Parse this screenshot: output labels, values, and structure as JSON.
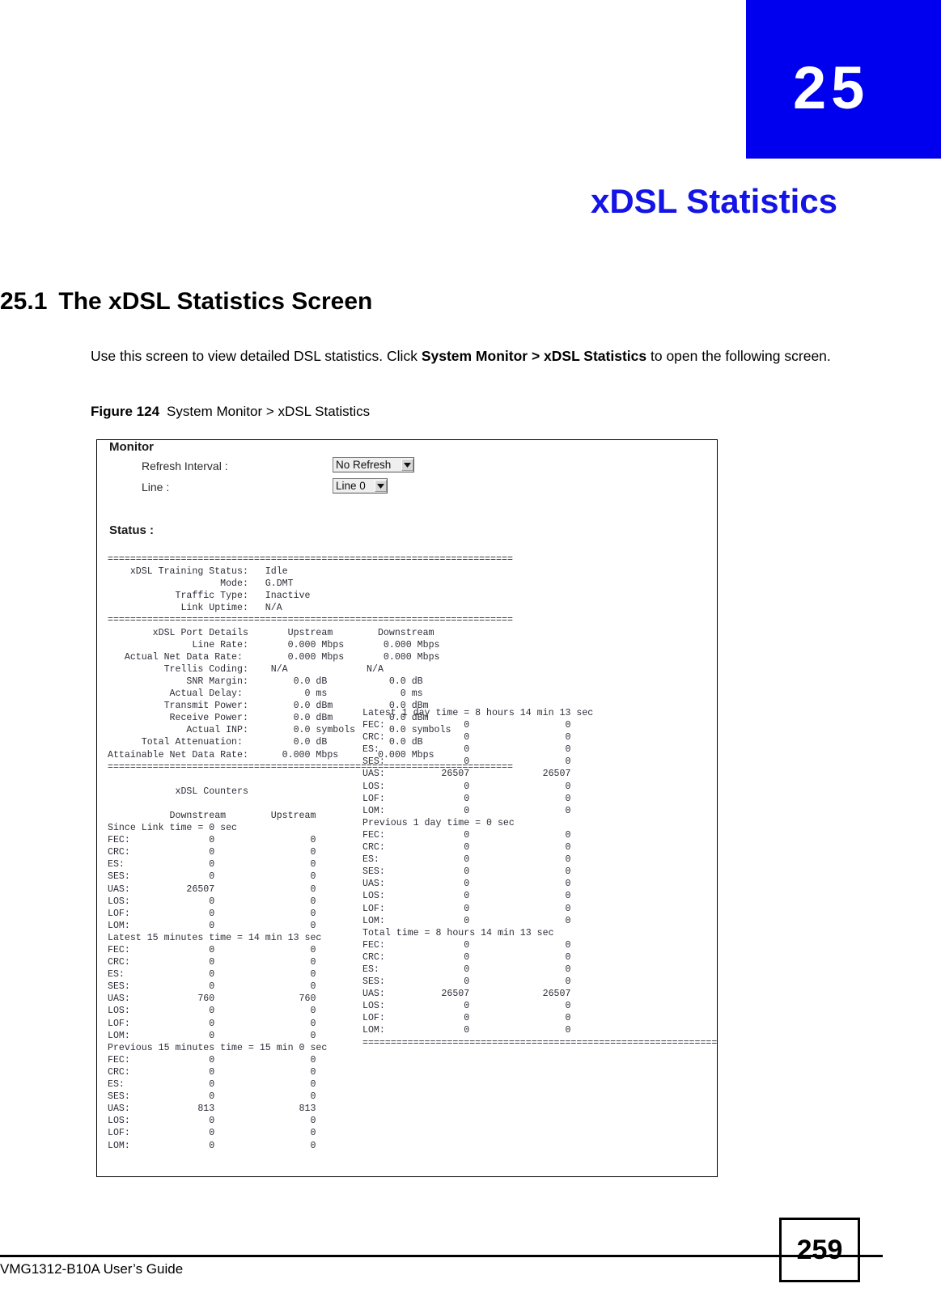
{
  "chapter": {
    "number": "25",
    "title": "xDSL Statistics"
  },
  "section": {
    "number": "25.1",
    "heading": "The xDSL Statistics Screen",
    "intro_pre": "Use this screen to view detailed DSL statistics. Click ",
    "intro_bold": "System Monitor > xDSL Statistics",
    "intro_post": " to open the following screen."
  },
  "figure": {
    "label": "Figure 124",
    "caption": "System Monitor > xDSL Statistics"
  },
  "screenshot": {
    "monitor_title": "Monitor",
    "refresh_interval_label": "Refresh Interval :",
    "refresh_interval_value": "No Refresh",
    "line_label": "Line :",
    "line_value": "Line 0",
    "status_label": "Status :",
    "console_left": "========================================================================\n    xDSL Training Status:   Idle\n                    Mode:   G.DMT\n            Traffic Type:   Inactive\n             Link Uptime:   N/A\n========================================================================\n        xDSL Port Details       Upstream        Downstream\n               Line Rate:       0.000 Mbps       0.000 Mbps\n   Actual Net Data Rate:        0.000 Mbps       0.000 Mbps\n          Trellis Coding:    N/A              N/A\n              SNR Margin:        0.0 dB           0.0 dB\n           Actual Delay:           0 ms             0 ms\n          Transmit Power:        0.0 dBm          0.0 dBm\n           Receive Power:        0.0 dBm          0.0 dBm\n              Actual INP:        0.0 symbols      0.0 symbols\n      Total Attenuation:         0.0 dB           0.0 dB\nAttainable Net Data Rate:      0.000 Mbps       0.000 Mbps\n========================================================================\n\n            xDSL Counters\n\n           Downstream        Upstream\nSince Link time = 0 sec\nFEC:              0                 0\nCRC:              0                 0\nES:               0                 0\nSES:              0                 0\nUAS:          26507                 0\nLOS:              0                 0\nLOF:              0                 0\nLOM:              0                 0\nLatest 15 minutes time = 14 min 13 sec\nFEC:              0                 0\nCRC:              0                 0\nES:               0                 0\nSES:              0                 0\nUAS:            760               760\nLOS:              0                 0\nLOF:              0                 0\nLOM:              0                 0\nPrevious 15 minutes time = 15 min 0 sec\nFEC:              0                 0\nCRC:              0                 0\nES:               0                 0\nSES:              0                 0\nUAS:            813               813\nLOS:              0                 0\nLOF:              0                 0\nLOM:              0                 0",
    "console_right": "Latest 1 day time = 8 hours 14 min 13 sec\nFEC:              0                 0\nCRC:              0                 0\nES:               0                 0\nSES:              0                 0\nUAS:          26507             26507\nLOS:              0                 0\nLOF:              0                 0\nLOM:              0                 0\nPrevious 1 day time = 0 sec\nFEC:              0                 0\nCRC:              0                 0\nES:               0                 0\nSES:              0                 0\nUAS:              0                 0\nLOS:              0                 0\nLOF:              0                 0\nLOM:              0                 0\nTotal time = 8 hours 14 min 13 sec\nFEC:              0                 0\nCRC:              0                 0\nES:               0                 0\nSES:              0                 0\nUAS:          26507             26507\nLOS:              0                 0\nLOF:              0                 0\nLOM:              0                 0\n========================================================================"
  },
  "footer": {
    "guide_title": "VMG1312-B10A User’s Guide",
    "page_number": "259"
  },
  "colors": {
    "chapter_block": "#0000ee",
    "chapter_title": "#1414e6",
    "console_text": "#2d2d38"
  }
}
